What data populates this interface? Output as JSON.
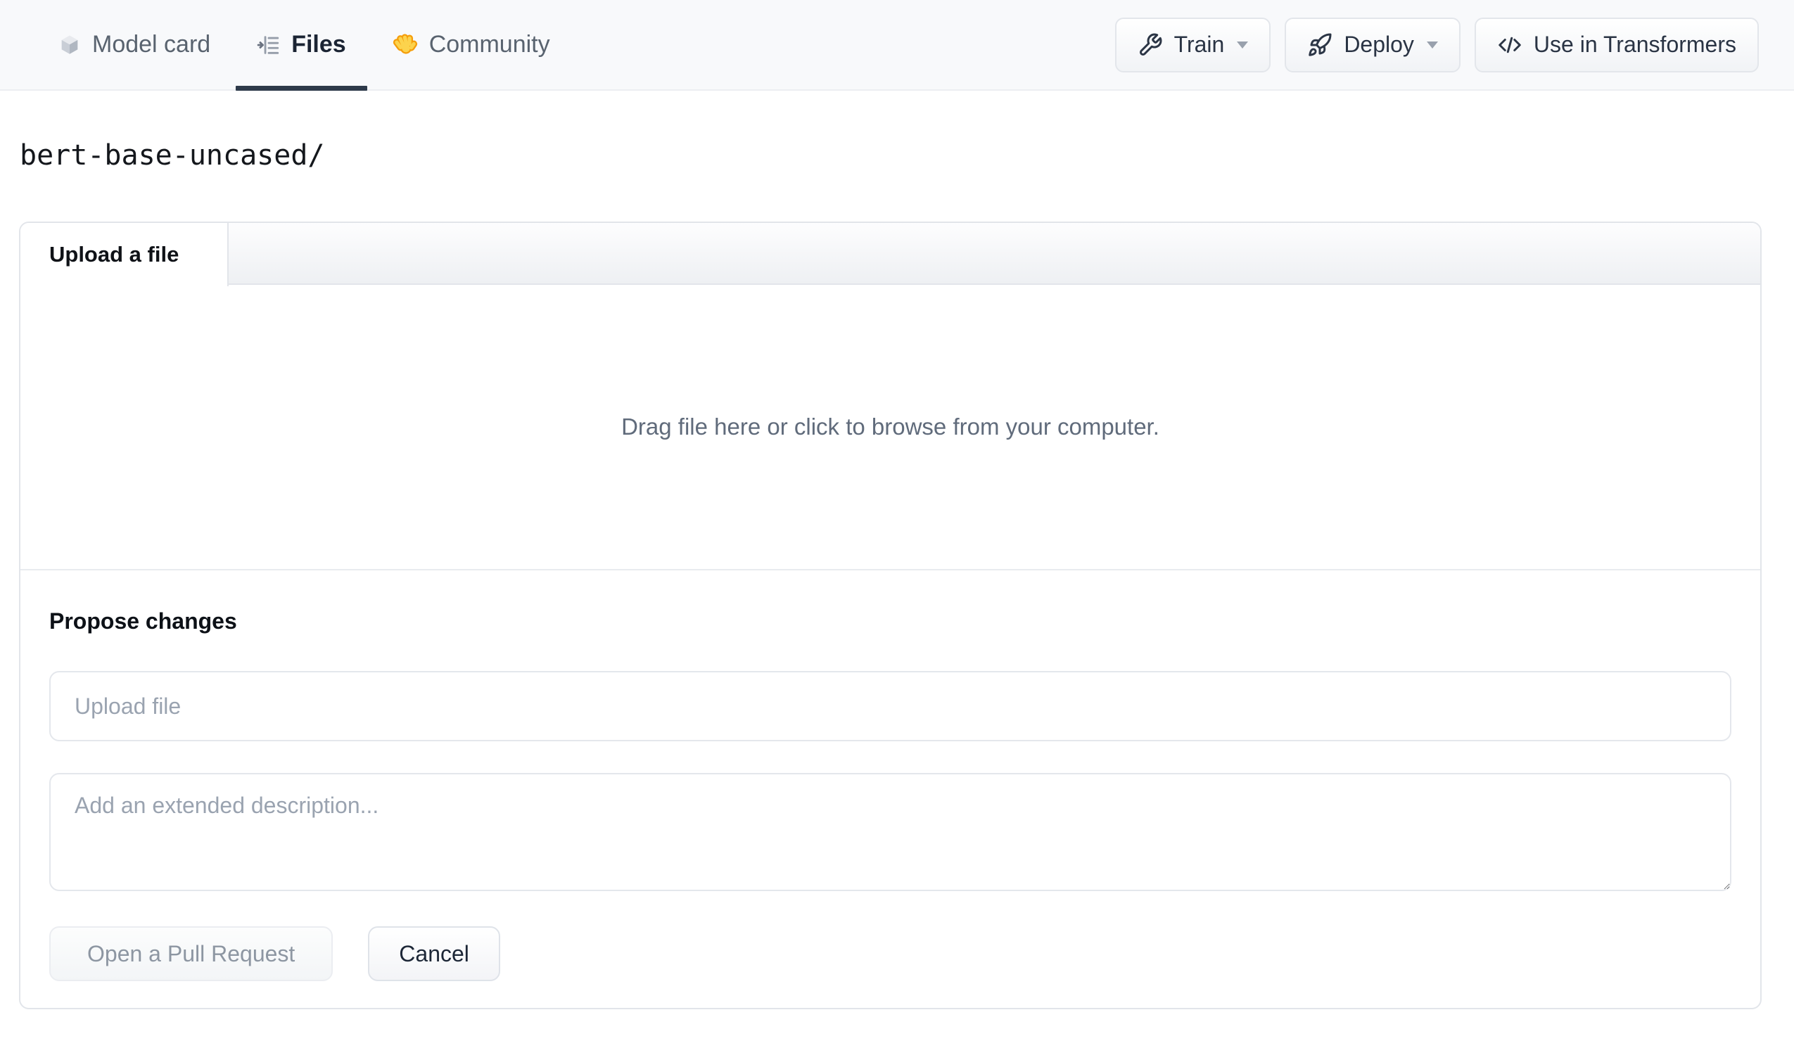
{
  "header": {
    "tabs": [
      {
        "label": "Model card",
        "icon": "cube-icon",
        "active": false
      },
      {
        "label": "Files",
        "icon": "files-icon",
        "active": true
      },
      {
        "label": "Community",
        "icon": "waving-hand-icon",
        "active": false
      }
    ],
    "actions": [
      {
        "label": "Train",
        "icon": "wrench-icon",
        "has_dropdown": true
      },
      {
        "label": "Deploy",
        "icon": "rocket-icon",
        "has_dropdown": true
      },
      {
        "label": "Use in Transformers",
        "icon": "code-icon",
        "has_dropdown": false
      }
    ]
  },
  "breadcrumb": {
    "path": "bert-base-uncased/"
  },
  "upload_card": {
    "tab_label": "Upload a file",
    "dropzone_text": "Drag file here or click to browse from your computer.",
    "propose": {
      "heading": "Propose changes",
      "file_input_placeholder": "Upload file",
      "description_placeholder": "Add an extended description...",
      "submit_label": "Open a Pull Request",
      "cancel_label": "Cancel"
    }
  },
  "colors": {
    "header_bg": "#f8f9fb",
    "active_tab_underline": "#2e3a4a",
    "active_tab_text": "#1b2433",
    "inactive_tab_text": "#59636f",
    "card_border": "#e2e5ea",
    "dropzone_text": "#606b7b",
    "placeholder_text": "#9aa3b0",
    "disabled_button_text": "#8d96a2",
    "hand_emoji_outline": "#f59e0b",
    "hand_emoji_fill": "#fcd34d"
  }
}
